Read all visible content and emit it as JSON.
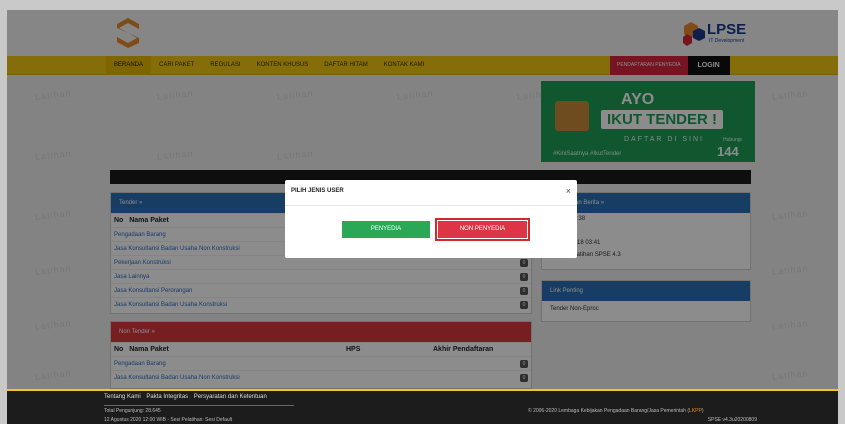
{
  "watermark": "Latihan",
  "header": {
    "lpse_logo": "LPSE",
    "lpse_subtitle": "IT Development"
  },
  "nav": {
    "items": [
      "BERANDA",
      "CARI PAKET",
      "REGULASI",
      "KONTEN KHUSUS",
      "DAFTAR HITAM",
      "KONTAK KAMI"
    ],
    "register": "PENDAFTARAN PENYEDIA",
    "login": "LOGIN"
  },
  "banner": {
    "line1": "AYO",
    "line2": "IKUT TENDER !",
    "line3": "DAFTAR DI SINI",
    "hashtag": "#KiniSaatnya #IkutTender",
    "hotline_label": "Hubungi",
    "hotline": "144"
  },
  "tender": {
    "title": "Tender »",
    "col_no": "No",
    "col_nama": "Nama Paket",
    "rows": [
      {
        "label": "Pengadaan Barang",
        "count": "0"
      },
      {
        "label": "Jasa Konsultansi Badan Usaha Non Konstruksi",
        "count": "0"
      },
      {
        "label": "Pekerjaan Konstruksi",
        "count": "0"
      },
      {
        "label": "Jasa Lainnya",
        "count": "0"
      },
      {
        "label": "Jasa Konsultansi Perorangan",
        "count": "0"
      },
      {
        "label": "Jasa Konsultansi Badan Usaha Konstruksi",
        "count": "0"
      }
    ]
  },
  "non_tender": {
    "title": "Non Tender »",
    "col_no": "No",
    "col_nama": "Nama Paket",
    "col_hps": "HPS",
    "col_akhir": "Akhir Pendaftaran",
    "rows": [
      {
        "label": "Pengadaan Barang",
        "count": "0"
      },
      {
        "label": "Jasa Konsultansi Badan Usaha Non Konstruksi",
        "count": "0"
      }
    ]
  },
  "news": {
    "title": "...uman dan Berita »",
    "item1_date": "...2020 14:38",
    "item1_text": "...sum",
    "item2_date": "...mber 2018 03:41",
    "item2_text": "Daftar Pelatihan SPSE 4.3"
  },
  "links": {
    "title": "Link Penting",
    "item1": "Tender Non-Eproc"
  },
  "modal": {
    "title": "PILIH JENIS USER",
    "close": "×",
    "btn_penyedia": "PENYEDIA",
    "btn_non_penyedia": "NON PENYEDIA"
  },
  "footer": {
    "links": [
      "Tentang Kami",
      "Pakta Integritas",
      "Persyaratan dan Ketentuan"
    ],
    "visitors": "Total Pengunjung: 28.645",
    "datetime": "12 Agustus 2020 12:00 WIB - Sesi Pelatihan: Sesi Default",
    "copyright": "© 2006-2020 Lembaga Kebijakan Pengadaan Barang/Jasa Pemerintah (",
    "lkpp": "LKPP",
    "copyright_end": ")",
    "version": "SPSE v4.3u20200809"
  },
  "colors": {
    "nav_yellow": "#f2c812",
    "tender_blue": "#2d6fb8",
    "non_tender_red": "#d9373f",
    "banner_green": "#1e9e57"
  }
}
